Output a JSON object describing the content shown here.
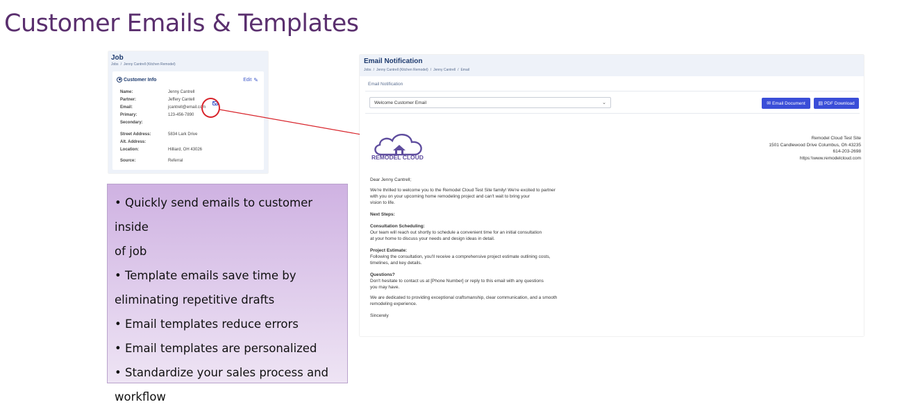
{
  "slide": {
    "title": "Customer Emails & Templates",
    "bullets": [
      "• Quickly send emails to customer inside",
      "of job",
      "• Template emails save time by",
      "eliminating repetitive drafts",
      "• Email templates reduce errors",
      "• Email templates are personalized",
      "• Standardize your sales process and",
      "workflow"
    ]
  },
  "colors": {
    "title": "#5a2f6e",
    "accent": "#3a4ed8",
    "highlight": "#d8232a",
    "bullet_box": "#cfb2e2"
  },
  "job_panel": {
    "title": "Job",
    "breadcrumb": [
      "Jobs",
      "Jenny Cantrell (Kitchen Remodel)"
    ],
    "card_title": "Customer Info",
    "edit_label": "Edit",
    "fields": [
      {
        "label": "Name:",
        "value": "Jenny Cantrell"
      },
      {
        "label": "Partner:",
        "value": "Jeffery Cantell"
      },
      {
        "label": "Email:",
        "value": "jcantrell@email.com"
      },
      {
        "label": "Primary:",
        "value": "123-456-7890"
      },
      {
        "label": "Secondary:",
        "value": ""
      },
      {
        "label": "Street Address:",
        "value": "5834 Lark Drive"
      },
      {
        "label": "Alt. Address:",
        "value": ""
      },
      {
        "label": "Location:",
        "value": "Hilliard, OH 43026"
      },
      {
        "label": "Source:",
        "value": "Referral"
      }
    ]
  },
  "email_panel": {
    "title": "Email Notification",
    "breadcrumb": [
      "Jobs",
      "Jenny Cantrell (Kitchen Remodel)",
      "Jenny Cantrell",
      "Email"
    ],
    "sub_label": "Email Notification",
    "template_select": "Welcome Customer Email",
    "email_document_label": "Email Document",
    "pdf_download_label": "PDF Download",
    "logo_text": "REMODEL CLOUD",
    "company": {
      "name": "Remodel Cloud Test Site",
      "address": "1501 Candlewood Drive Columbus, Oh 43235",
      "phone": "614-203-2698",
      "website": "https:\\\\www.remodelcloud.com"
    },
    "body": {
      "greeting": "Dear Jenny Cantrell;",
      "intro": [
        "We're thrilled to welcome you to the Remodel Cloud Test Site family! We're excited to partner",
        "with you on your upcoming home remodeling project and can't wait to bring your",
        "vision to life."
      ],
      "next_steps": "Next Steps:",
      "consult_heading": "Consultation Scheduling:",
      "consult_text": [
        "Our team will reach out shortly to schedule a convenient time for an initial consultation",
        "at your home to discuss your needs and design ideas in detail."
      ],
      "estimate_heading": "Project Estimate:",
      "estimate_text": [
        "Following the consultation, you'll receive a comprehensive project estimate outlining costs,",
        "timelines, and key details."
      ],
      "questions_heading": "Questions?",
      "questions_text": [
        "Don't hesitate to contact us at [Phone Number] or reply to this email with any questions",
        "you may have."
      ],
      "closing_text": [
        "We are dedicated to providing exceptional craftsmanship, clear communication, and a smooth",
        " remodeling experience."
      ],
      "signoff": "Sincerely"
    }
  }
}
